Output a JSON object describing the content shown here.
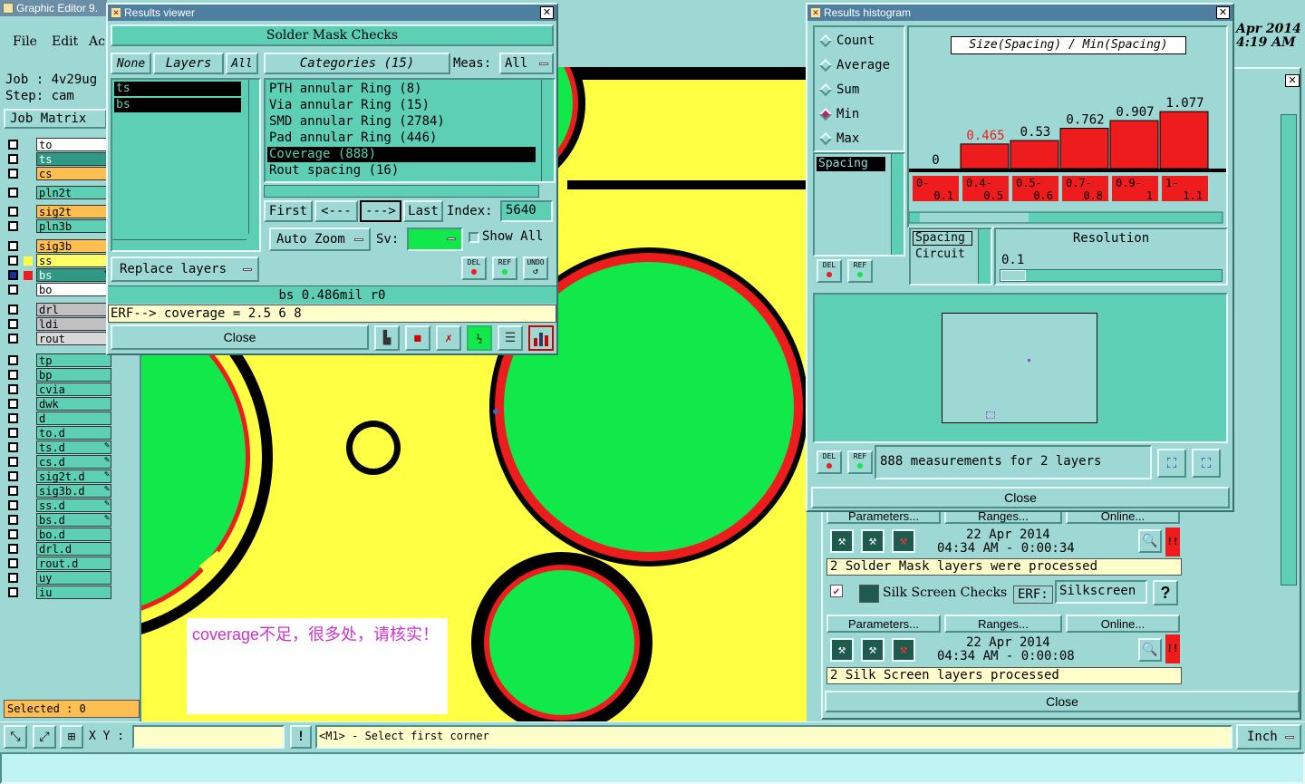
{
  "main_window": {
    "title": "Graphic Editor 9.",
    "menu": [
      "File",
      "Edit",
      "Ac"
    ],
    "job_label": "Job : 4v29ug",
    "step_label": "Step: cam",
    "job_matrix_button": "Job Matrix",
    "layers": [
      {
        "name": "to",
        "color": "#ffffff"
      },
      {
        "name": "ts",
        "color": "#2e9a85"
      },
      {
        "name": "cs",
        "color": "#ffbe4f"
      },
      {
        "name": "pln2t",
        "color": "#5ccfb4"
      },
      {
        "name": "sig2t",
        "color": "#ffbe4f"
      },
      {
        "name": "pln3b",
        "color": "#5ccfb4"
      },
      {
        "name": "sig3b",
        "color": "#ffbe4f"
      },
      {
        "name": "ss",
        "color": "#ffff66"
      },
      {
        "name": "bs",
        "color": "#2e9a85"
      },
      {
        "name": "bo",
        "color": "#ffffff"
      },
      {
        "name": "drl",
        "color": "#c0c0c0"
      },
      {
        "name": "ldi",
        "color": "#c0c0c0"
      },
      {
        "name": "rout",
        "color": "#d8d8d8"
      },
      {
        "name": "tp",
        "color": "#5ccfb4"
      },
      {
        "name": "bp",
        "color": "#5ccfb4"
      },
      {
        "name": "cvia",
        "color": "#5ccfb4"
      },
      {
        "name": "dwk",
        "color": "#5ccfb4"
      },
      {
        "name": "d",
        "color": "#5ccfb4"
      },
      {
        "name": "to.d",
        "color": "#5ccfb4"
      },
      {
        "name": "ts.d",
        "color": "#5ccfb4"
      },
      {
        "name": "cs.d",
        "color": "#5ccfb4"
      },
      {
        "name": "sig2t.d",
        "color": "#5ccfb4"
      },
      {
        "name": "sig3b.d",
        "color": "#5ccfb4"
      },
      {
        "name": "ss.d",
        "color": "#5ccfb4"
      },
      {
        "name": "bs.d",
        "color": "#5ccfb4"
      },
      {
        "name": "bo.d",
        "color": "#5ccfb4"
      },
      {
        "name": "drl.d",
        "color": "#5ccfb4"
      },
      {
        "name": "rout.d",
        "color": "#5ccfb4"
      },
      {
        "name": "uy",
        "color": "#5ccfb4"
      },
      {
        "name": "iu",
        "color": "#5ccfb4"
      }
    ],
    "selected_label": "Selected : 0",
    "xy_label": "X Y :",
    "status_message": "<M1> - Select first corner",
    "units": "Inch",
    "date_corner": "Apr 2014",
    "time_corner": "4:19 AM"
  },
  "annotation": {
    "text": "coverage不足，很多处，请核实！",
    "color": "#cc33cc"
  },
  "results_viewer": {
    "title": "Results viewer",
    "header": "Solder Mask Checks",
    "none_button": "None",
    "layers_button": "Layers",
    "all_button": "All",
    "categories_button": "Categories (15)",
    "meas_label": "Meas:",
    "meas_value": "All",
    "layer_items": [
      "ts",
      "bs"
    ],
    "categories": [
      "PTH annular Ring (8)",
      "Via annular Ring (15)",
      "SMD annular Ring (2784)",
      "Pad annular Ring (446)",
      "Coverage (888)",
      "Rout spacing (16)"
    ],
    "selected_category": 4,
    "first_button": "First",
    "prev_button": "<---",
    "next_button": "--->",
    "last_button": "Last",
    "index_label": "Index:",
    "index_value": "5640",
    "auto_zoom_button": "Auto Zoom",
    "sv_label": "Sv:",
    "show_all_label": "Show All",
    "replace_layers_button": "Replace layers",
    "del_label": "DEL",
    "ref_label": "REF",
    "undo_label": "UNDO",
    "status_line": "bs 0.486mil  r0",
    "erf_line": "ERF--> coverage = 2.5 6 8",
    "close_button": "Close"
  },
  "results_histogram": {
    "title": "Results histogram",
    "modes": [
      "Count",
      "Average",
      "Sum",
      "Min",
      "Max"
    ],
    "selected_mode": "Min",
    "header": "Size(Spacing) / Min(Spacing)",
    "list_item": "Spacing",
    "del_label": "DEL",
    "ref_label": "REF",
    "chart_data": {
      "type": "bar",
      "title": "Size(Spacing) / Min(Spacing)",
      "categories": [
        "0-0.1",
        "0.4-0.5",
        "0.5-0.6",
        "0.7-0.8",
        "0.9-1",
        "1-1.1"
      ],
      "category_lines": [
        [
          "0-",
          "0.1"
        ],
        [
          "0.4-",
          "0.5"
        ],
        [
          "0.5-",
          "0.6"
        ],
        [
          "0.7-",
          "0.8"
        ],
        [
          "0.9-",
          "1"
        ],
        [
          "1-",
          "1.1"
        ]
      ],
      "values": [
        0,
        0.465,
        0.53,
        0.762,
        0.907,
        1.077
      ],
      "value_labels": [
        "0",
        "0.465",
        "0.53",
        "0.762",
        "0.907",
        "1.077"
      ],
      "ylim": [
        0,
        1.2
      ],
      "bar_color": "#ee1c1c",
      "highlight_label_color": "#ee1c1c",
      "highlight_index": 1
    },
    "param_items": [
      "Spacing",
      "Circuit"
    ],
    "resolution_label": "Resolution",
    "resolution_value": "0.1",
    "measurements_text": "888 measurements for 2 layers",
    "close_button": "Close"
  },
  "checklist_panel": {
    "parameters_button": "Parameters...",
    "ranges_button": "Ranges...",
    "online_button": "Online...",
    "run1_date": "22 Apr 2014",
    "run1_time": "04:34 AM - 0:00:34",
    "run1_message": "2 Solder Mask layers were processed",
    "silk_label": "Silk Screen Checks",
    "erf_label": "ERF:",
    "erf_value": "Silkscreen",
    "help": "?",
    "run2_date": "22 Apr 2014",
    "run2_time": "04:34 AM - 0:00:08",
    "run2_message": "2 Silk Screen layers processed",
    "alert": "!!",
    "close_button": "Close"
  }
}
